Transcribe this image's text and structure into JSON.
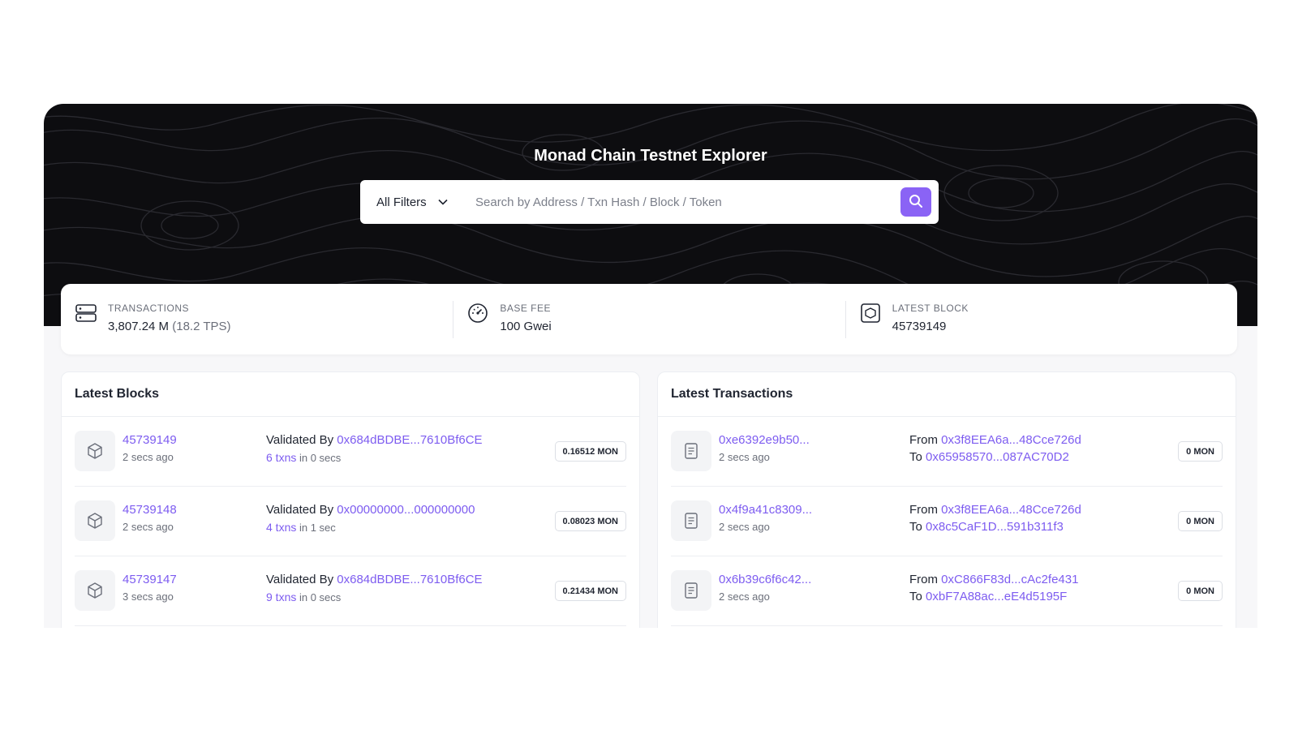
{
  "hero": {
    "title": "Monad Chain Testnet Explorer"
  },
  "search": {
    "filter_label": "All Filters",
    "placeholder": "Search by Address / Txn Hash / Block / Token",
    "value": ""
  },
  "stats": {
    "transactions": {
      "label": "TRANSACTIONS",
      "value": "3,807.24 M",
      "extra": "(18.2 TPS)",
      "icon": "server-icon"
    },
    "base_fee": {
      "label": "BASE FEE",
      "value": "100 Gwei",
      "icon": "gauge-icon"
    },
    "latest_block": {
      "label": "LATEST BLOCK",
      "value": "45739149",
      "icon": "block-icon"
    }
  },
  "latest_blocks": {
    "title": "Latest Blocks",
    "rows": [
      {
        "block": "45739149",
        "age": "2 secs ago",
        "validated_label": "Validated By",
        "validator": "0x684dBDBE...7610Bf6CE",
        "txns": "6 txns",
        "duration": "in 0 secs",
        "reward": "0.16512 MON"
      },
      {
        "block": "45739148",
        "age": "2 secs ago",
        "validated_label": "Validated By",
        "validator": "0x00000000...000000000",
        "txns": "4 txns",
        "duration": "in 1 sec",
        "reward": "0.08023 MON"
      },
      {
        "block": "45739147",
        "age": "3 secs ago",
        "validated_label": "Validated By",
        "validator": "0x684dBDBE...7610Bf6CE",
        "txns": "9 txns",
        "duration": "in 0 secs",
        "reward": "0.21434 MON"
      }
    ]
  },
  "latest_transactions": {
    "title": "Latest Transactions",
    "rows": [
      {
        "hash": "0xe6392e9b50...",
        "age": "2 secs ago",
        "from_label": "From",
        "from": "0x3f8EEA6a...48Cce726d",
        "to_label": "To",
        "to": "0x65958570...087AC70D2",
        "value": "0 MON"
      },
      {
        "hash": "0x4f9a41c8309...",
        "age": "2 secs ago",
        "from_label": "From",
        "from": "0x3f8EEA6a...48Cce726d",
        "to_label": "To",
        "to": "0x8c5CaF1D...591b311f3",
        "value": "0 MON"
      },
      {
        "hash": "0x6b39c6f6c42...",
        "age": "2 secs ago",
        "from_label": "From",
        "from": "0xC866F83d...cAc2fe431",
        "to_label": "To",
        "to": "0xbF7A88ac...eE4d5195F",
        "value": "0 MON"
      }
    ]
  },
  "colors": {
    "accent": "#8a63f5",
    "link": "#7d5cf0",
    "hero_bg": "#0d0d10"
  }
}
